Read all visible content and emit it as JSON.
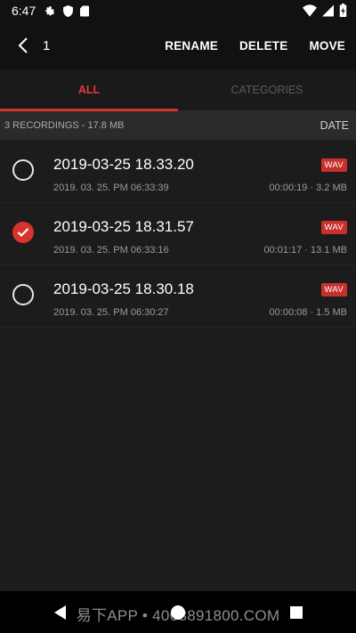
{
  "status_bar": {
    "time": "6:47"
  },
  "app_bar": {
    "selected_count": "1",
    "actions": {
      "rename": "RENAME",
      "delete": "DELETE",
      "move": "MOVE"
    }
  },
  "tabs": [
    {
      "label": "ALL",
      "active": true
    },
    {
      "label": "CATEGORIES",
      "active": false
    }
  ],
  "summary": {
    "text": "3 RECORDINGS - 17.8 MB",
    "sort_label": "DATE"
  },
  "recordings": [
    {
      "name": "2019-03-25 18.33.20",
      "date": "2019. 03. 25. PM 06:33:39",
      "format": "WAV",
      "meta": "00:00:19 · 3.2 MB",
      "selected": false
    },
    {
      "name": "2019-03-25 18.31.57",
      "date": "2019. 03. 25. PM 06:33:16",
      "format": "WAV",
      "meta": "00:01:17 · 13.1 MB",
      "selected": true
    },
    {
      "name": "2019-03-25 18.30.18",
      "date": "2019. 03. 25. PM 06:30:27",
      "format": "WAV",
      "meta": "00:00:08 · 1.5 MB",
      "selected": false
    }
  ],
  "watermark": "易下APP • 4008891800.COM",
  "colors": {
    "accent": "#d8342e",
    "badge": "#c9302c",
    "background": "#1c1c1c",
    "bar": "#111111"
  }
}
